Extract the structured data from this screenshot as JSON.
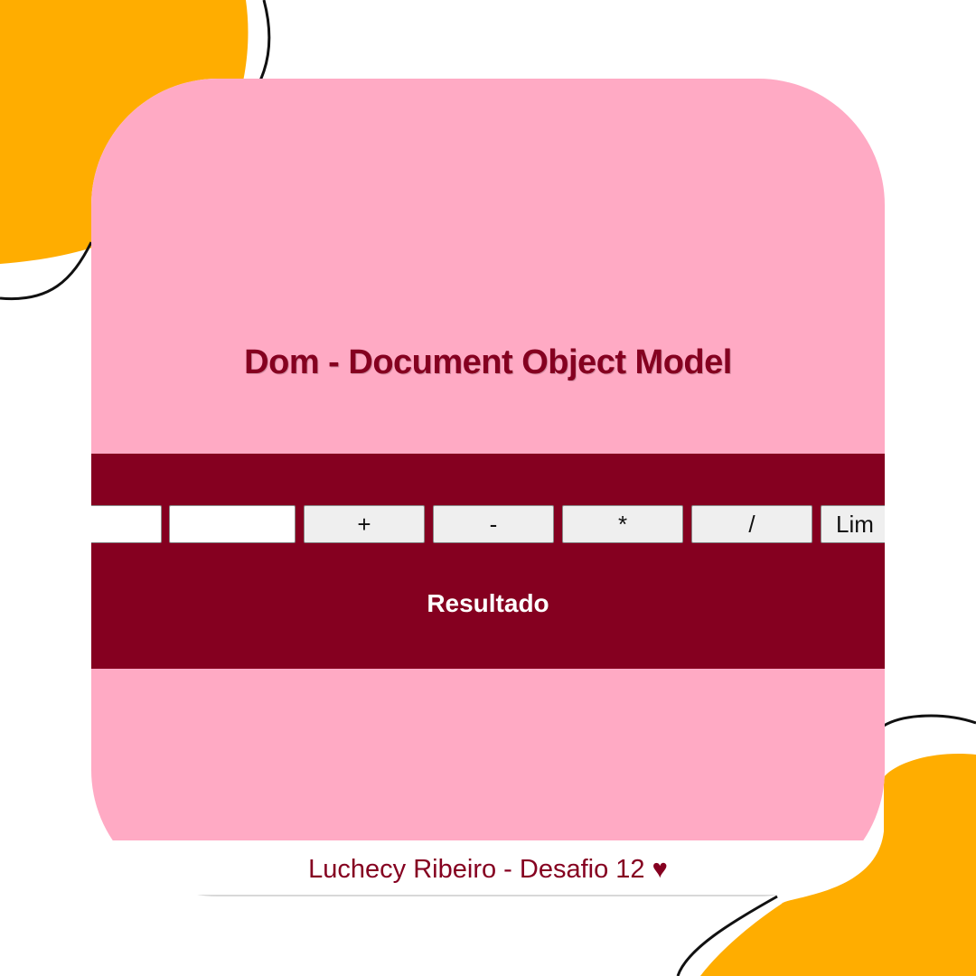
{
  "colors": {
    "page_bg": "#ffffff",
    "card_bg": "#ffaac4",
    "band_bg": "#850020",
    "title_color": "#850020",
    "accent_blob": "#ffad00"
  },
  "header": {
    "title": "Dom - Document Object Model"
  },
  "calculator": {
    "input1": {
      "value": "",
      "placeholder": ""
    },
    "input2": {
      "value": "",
      "placeholder": ""
    },
    "buttons": {
      "add": "+",
      "subtract": "-",
      "multiply": "*",
      "divide": "/",
      "clear": "Lim"
    },
    "result_label": "Resultado"
  },
  "footer": {
    "credit": "Luchecy Ribeiro - Desafio 12 ♥"
  }
}
